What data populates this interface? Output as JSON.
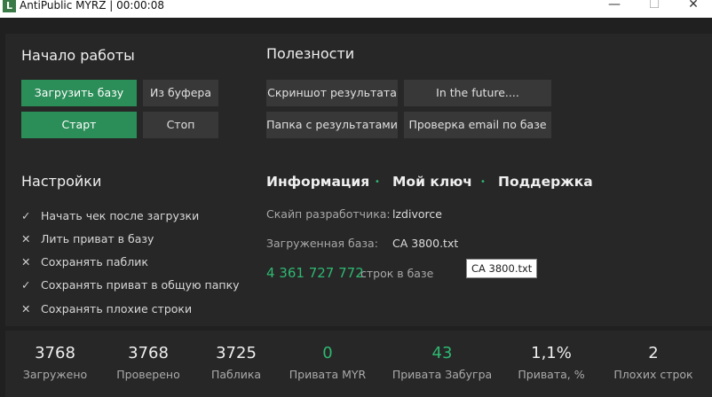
{
  "window": {
    "icon_letter": "L",
    "title": "AntiPublic MYRZ | 00:00:08",
    "minimize": "—",
    "maximize": "☐",
    "close": "✕"
  },
  "start": {
    "title": "Начало работы",
    "load_base": "Загрузить базу",
    "from_clipboard": "Из буфера",
    "start": "Старт",
    "stop": "Стоп"
  },
  "useful": {
    "title": "Полезности",
    "screenshot": "Скриншот результата",
    "future": "In the future....",
    "results_folder": "Папка с результатами",
    "email_check": "Проверка email по базе"
  },
  "settings": {
    "title": "Настройки",
    "items": [
      {
        "label": "Начать чек после загрузки",
        "checked": true,
        "mark": "✓"
      },
      {
        "label": "Лить приват в базу",
        "checked": false,
        "mark": "✕"
      },
      {
        "label": "Сохранять паблик",
        "checked": false,
        "mark": "✕"
      },
      {
        "label": "Сохранять приват в общую папку",
        "checked": true,
        "mark": "✓"
      },
      {
        "label": "Сохранять плохие строки",
        "checked": false,
        "mark": "✕"
      }
    ]
  },
  "info": {
    "tab_info": "Информация",
    "tab_key": "Мой ключ",
    "tab_support": "Поддержка",
    "dot": "•",
    "skype_label": "Скайп разработчика:",
    "skype_value": "lzdivorce",
    "base_label": "Загруженная база:",
    "base_value": "CA 3800.txt",
    "line_count": "4 361 727 772",
    "line_count_label": "строк в базе",
    "tooltip": "CA 3800.txt"
  },
  "stats": [
    {
      "value": "3768",
      "label": "Загружено",
      "accent": false
    },
    {
      "value": "3768",
      "label": "Проверено",
      "accent": false
    },
    {
      "value": "3725",
      "label": "Паблика",
      "accent": false
    },
    {
      "value": "0",
      "label": "Привата MYR",
      "accent": true
    },
    {
      "value": "43",
      "label": "Привата Забугра",
      "accent": true
    },
    {
      "value": "1,1%",
      "label": "Привата, %",
      "accent": false
    },
    {
      "value": "2",
      "label": "Плохих строк",
      "accent": false
    }
  ],
  "colors": {
    "accent": "#2eb872",
    "button_green": "#2b8d58",
    "background": "#202020",
    "panel": "#272727"
  }
}
